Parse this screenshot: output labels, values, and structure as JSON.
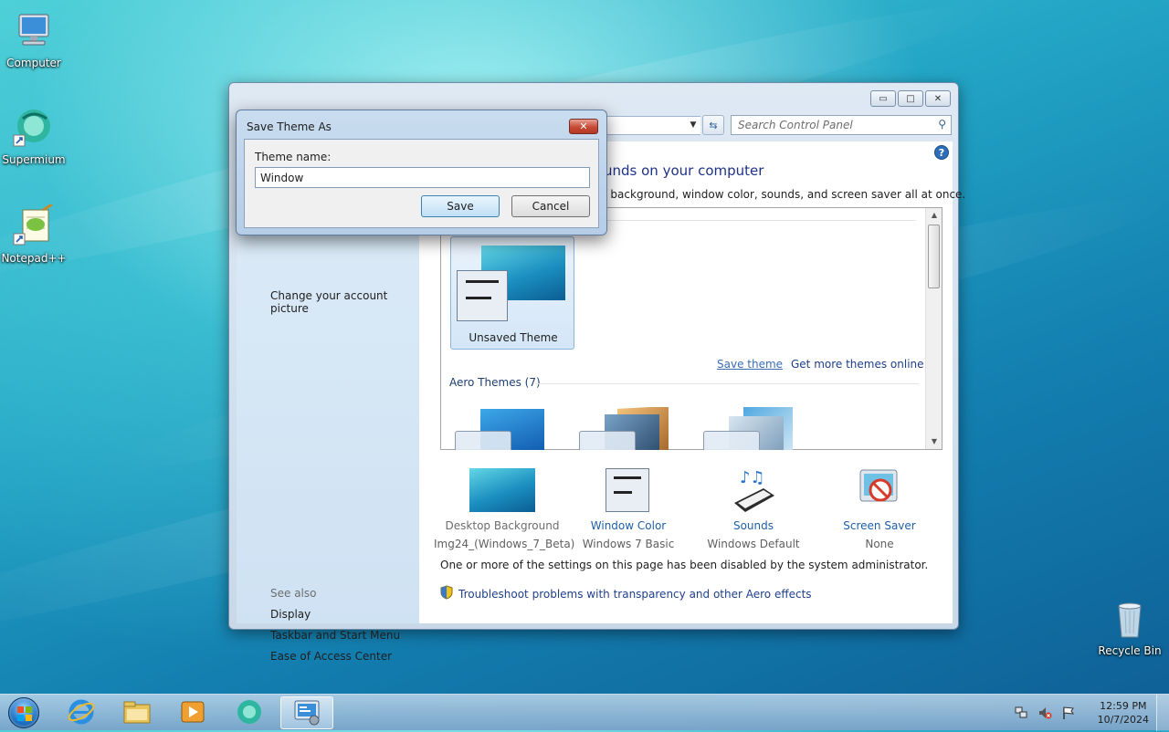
{
  "desktop": {
    "icons": [
      {
        "label": "Computer"
      },
      {
        "label": "Supermium"
      },
      {
        "label": "Notepad++"
      },
      {
        "label": "Recycle Bin"
      }
    ]
  },
  "window": {
    "search_placeholder": "Search Control Panel",
    "title_fragment": "unds on your computer",
    "description_fragment": "p background, window color, sounds, and screen saver all at once.",
    "left_pane": {
      "account_link": "Change your account picture",
      "see_also": "See also",
      "links": [
        "Display",
        "Taskbar and Start Menu",
        "Ease of Access Center"
      ]
    },
    "themes": {
      "unsaved_label": "Unsaved Theme",
      "save_theme": "Save theme",
      "get_more": "Get more themes online",
      "aero_header": "Aero Themes (7)"
    },
    "settings": [
      {
        "label": "Desktop Background",
        "sub": "Img24_(Windows_7_Beta)",
        "enabled": false
      },
      {
        "label": "Window Color",
        "sub": "Windows 7 Basic",
        "enabled": true
      },
      {
        "label": "Sounds",
        "sub": "Windows Default",
        "enabled": true
      },
      {
        "label": "Screen Saver",
        "sub": "None",
        "enabled": true
      }
    ],
    "disabled_note": "One or more of the settings on this page has been disabled by the system administrator.",
    "troubleshoot": "Troubleshoot problems with transparency and other Aero effects"
  },
  "dialog": {
    "title": "Save Theme As",
    "label": "Theme name:",
    "value": "Window",
    "save": "Save",
    "cancel": "Cancel"
  },
  "taskbar": {
    "time": "12:59 PM",
    "date": "10/7/2024"
  },
  "colors": {
    "link": "#1e5fa8",
    "title_blue": "#1e3287",
    "close_red": "#c74a35"
  }
}
